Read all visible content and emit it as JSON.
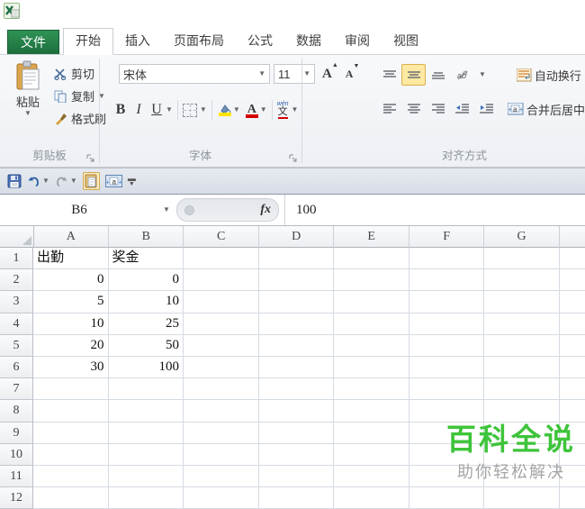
{
  "tabbar": {
    "file_tab": "文件",
    "tabs": [
      "开始",
      "插入",
      "页面布局",
      "公式",
      "数据",
      "审阅",
      "视图"
    ],
    "active_tab": "开始"
  },
  "ribbon": {
    "clipboard": {
      "group_label": "剪贴板",
      "paste_label": "粘贴",
      "cut_label": "剪切",
      "copy_label": "复制",
      "format_painter_label": "格式刷"
    },
    "font": {
      "group_label": "字体",
      "font_name": "宋体",
      "font_size": "11",
      "bold_label": "B",
      "italic_label": "I",
      "underline_label": "U",
      "grow_font_label": "A",
      "shrink_font_label": "A",
      "phonetic_pinyin": "wén",
      "phonetic_han": "文",
      "fill_color": "#ffe600",
      "font_color": "#d40000"
    },
    "alignment": {
      "group_label": "对齐方式",
      "wrap_text_label": "自动换行",
      "merge_center_label": "合并后居中"
    }
  },
  "quick_access": {
    "icons": [
      "save-icon",
      "undo-icon",
      "redo-icon",
      "paste-doc-icon",
      "merge-cells-icon",
      "customize-qat-icon"
    ]
  },
  "formula_bar": {
    "name_box_value": "B6",
    "fx_label": "fx",
    "formula_value": "100"
  },
  "grid": {
    "columns": [
      "A",
      "B",
      "C",
      "D",
      "E",
      "F",
      "G",
      ""
    ],
    "rows": [
      {
        "n": "1",
        "cells": [
          "出勤",
          "奖金",
          "",
          "",
          "",
          "",
          "",
          ""
        ]
      },
      {
        "n": "2",
        "cells": [
          "0",
          "0",
          "",
          "",
          "",
          "",
          "",
          ""
        ]
      },
      {
        "n": "3",
        "cells": [
          "5",
          "10",
          "",
          "",
          "",
          "",
          "",
          ""
        ]
      },
      {
        "n": "4",
        "cells": [
          "10",
          "25",
          "",
          "",
          "",
          "",
          "",
          ""
        ]
      },
      {
        "n": "5",
        "cells": [
          "20",
          "50",
          "",
          "",
          "",
          "",
          "",
          ""
        ]
      },
      {
        "n": "6",
        "cells": [
          "30",
          "100",
          "",
          "",
          "",
          "",
          "",
          ""
        ]
      },
      {
        "n": "7",
        "cells": [
          "",
          "",
          "",
          "",
          "",
          "",
          "",
          ""
        ]
      },
      {
        "n": "8",
        "cells": [
          "",
          "",
          "",
          "",
          "",
          "",
          "",
          ""
        ]
      },
      {
        "n": "9",
        "cells": [
          "",
          "",
          "",
          "",
          "",
          "",
          "",
          ""
        ]
      },
      {
        "n": "10",
        "cells": [
          "",
          "",
          "",
          "",
          "",
          "",
          "",
          ""
        ]
      },
      {
        "n": "11",
        "cells": [
          "",
          "",
          "",
          "",
          "",
          "",
          "",
          ""
        ]
      },
      {
        "n": "12",
        "cells": [
          "",
          "",
          "",
          "",
          "",
          "",
          "",
          ""
        ]
      }
    ]
  },
  "selection": {
    "active_cell": "B6"
  },
  "watermark": {
    "title": "百科全说",
    "subtitle": "助你轻松解决",
    "title_color": "#3ec43a",
    "subtitle_color": "#a5a5a5"
  }
}
